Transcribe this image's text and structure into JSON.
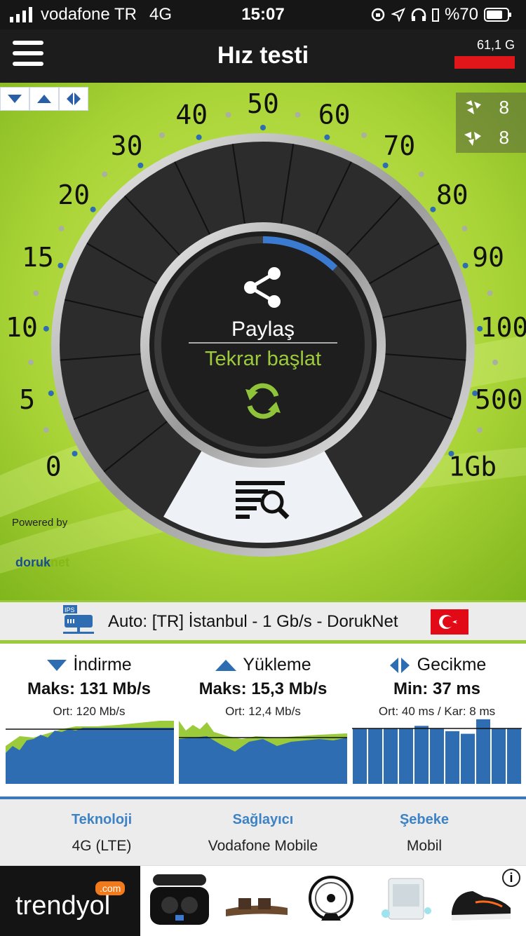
{
  "status": {
    "carrier": "vodafone TR",
    "network": "4G",
    "time": "15:07",
    "battery": "%70"
  },
  "appbar": {
    "title": "Hız testi",
    "data_usage": "61,1 G"
  },
  "gauge": {
    "labels": [
      "0",
      "5",
      "10",
      "15",
      "20",
      "30",
      "40",
      "50",
      "60",
      "70",
      "80",
      "90",
      "100",
      "500",
      "1Gb"
    ],
    "progress_fraction": 0.12,
    "counter_top": "8",
    "counter_bottom": "8",
    "share_label": "Paylaş",
    "restart_label": "Tekrar başlat",
    "powered_by": "Powered by",
    "brand_left": "doruk",
    "brand_right": "net"
  },
  "server": {
    "badge": "IPS",
    "text": "Auto: [TR] İstanbul - 1 Gb/s - DorukNet"
  },
  "stats": {
    "download": {
      "label": "İndirme",
      "max": "Maks: 131 Mb/s",
      "avg": "Ort: 120 Mb/s"
    },
    "upload": {
      "label": "Yükleme",
      "max": "Maks: 15,3 Mb/s",
      "avg": "Ort: 12,4 Mb/s"
    },
    "latency": {
      "label": "Gecikme",
      "min": "Min: 37 ms",
      "avg": "Ort: 40 ms / Kar: 8 ms",
      "bars": [
        0.84,
        0.84,
        0.84,
        0.84,
        0.88,
        0.84,
        0.8,
        0.76,
        0.98,
        0.84,
        0.84
      ]
    }
  },
  "network": {
    "tech_label": "Teknoloji",
    "tech_value": "4G (LTE)",
    "provider_label": "Sağlayıcı",
    "provider_value": "Vodafone Mobile",
    "net_label": "Şebeke",
    "net_value": "Mobil"
  },
  "ad": {
    "brand": "trendyol",
    "brand_suffix": ".com",
    "info": "i"
  },
  "colors": {
    "accent_blue": "#3d78b9",
    "accent_green": "#9bcb3b",
    "red": "#e0161b"
  }
}
